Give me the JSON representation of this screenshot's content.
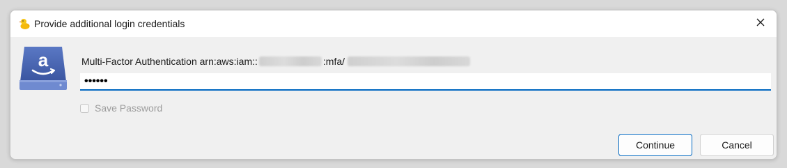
{
  "window": {
    "title": "Provide additional login credentials",
    "app_icon": "duck-icon",
    "close_icon": "close-icon"
  },
  "dialog": {
    "provider_icon": "amazon-drive-icon",
    "prompt_prefix": "Multi-Factor Authentication arn:aws:iam::",
    "prompt_middle": ":mfa/",
    "password_mask": "••••••",
    "save_password_label": "Save Password",
    "save_password_checked": false,
    "save_password_enabled": false
  },
  "buttons": {
    "continue_label": "Continue",
    "cancel_label": "Cancel"
  },
  "colors": {
    "accent": "#0067c0",
    "amazon_blue": "#3d5aa8"
  }
}
